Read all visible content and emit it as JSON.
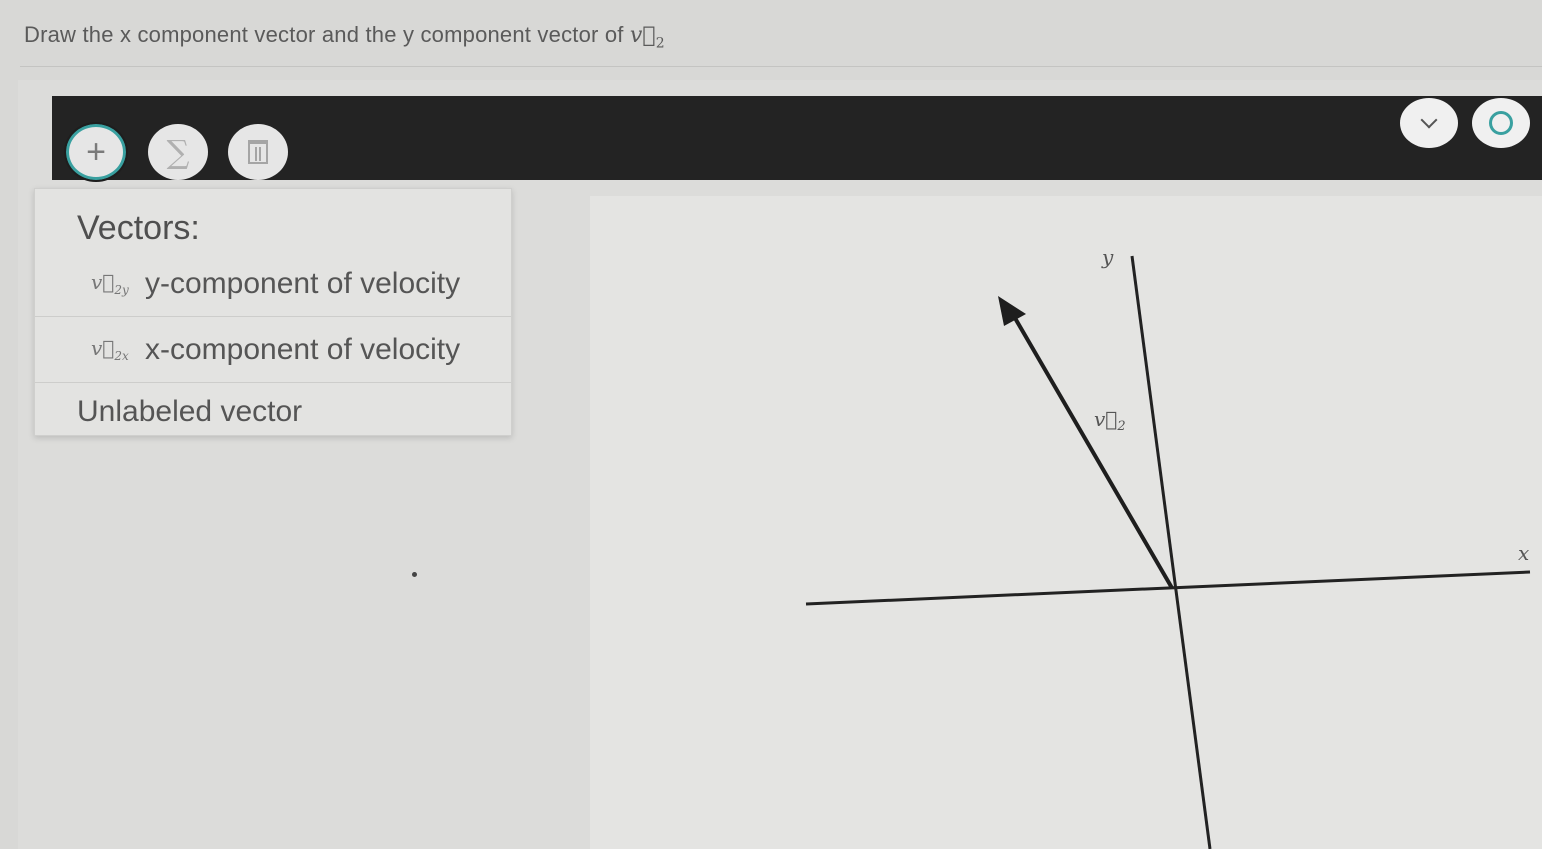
{
  "prompt": {
    "text": "Draw the x component vector and the y component vector of ",
    "vector_symbol": "v⃗",
    "vector_subscript": "2"
  },
  "toolbar": {
    "add_icon": "plus-icon",
    "add_glyph": "+",
    "sum_icon": "sigma-icon",
    "sum_glyph": "∑",
    "delete_icon": "trash-icon",
    "check_icon": "chevron-down-icon",
    "reset_icon": "reset-icon",
    "accent_color": "#39a0a0"
  },
  "vector_menu": {
    "title": "Vectors:",
    "items": [
      {
        "symbol": "v⃗",
        "subscript": "2y",
        "label": "y-component of velocity"
      },
      {
        "symbol": "v⃗",
        "subscript": "2x",
        "label": "x-component of velocity"
      },
      {
        "label": "Unlabeled vector"
      }
    ]
  },
  "graph": {
    "x_axis_label": "x",
    "y_axis_label": "y",
    "vector_label_symbol": "v⃗",
    "vector_label_subscript": "2"
  }
}
